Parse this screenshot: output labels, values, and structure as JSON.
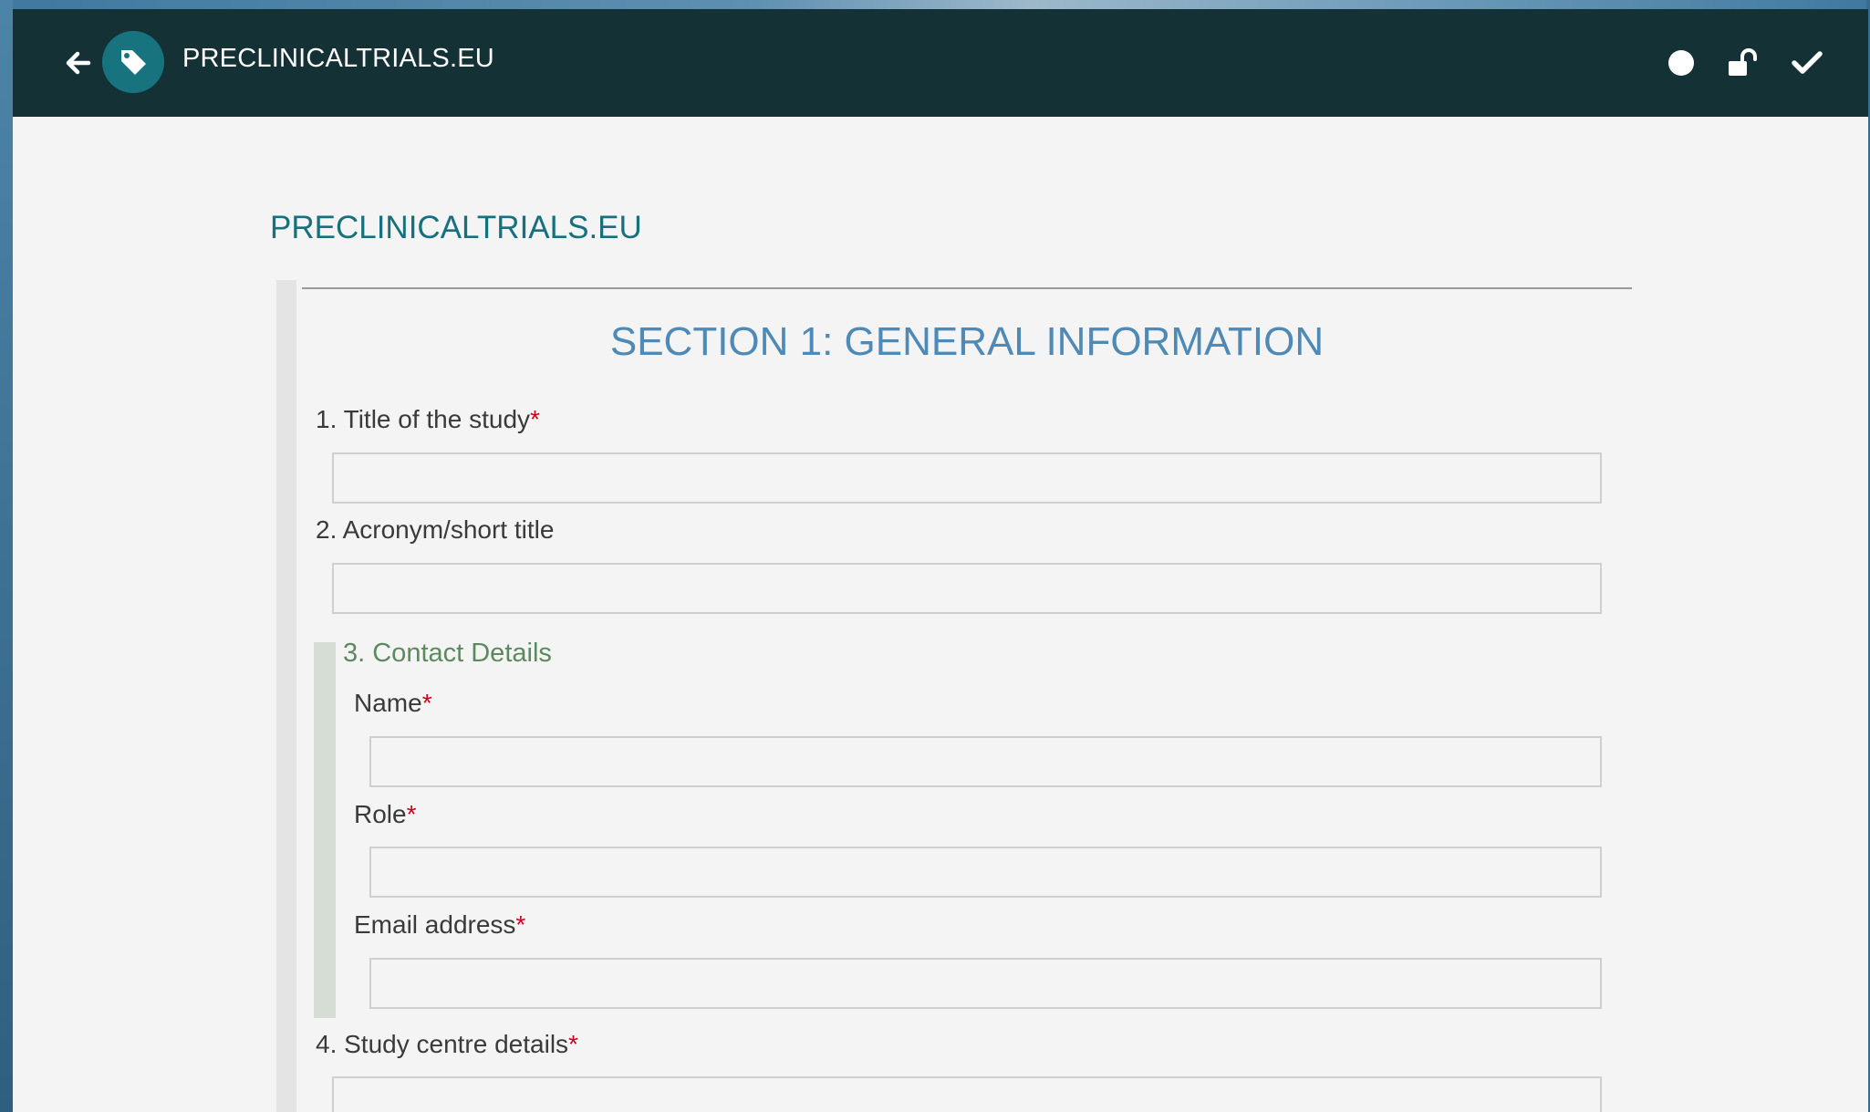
{
  "topbar": {
    "title": "PRECLINICALTRIALS.EU",
    "back_icon": "arrow-left-icon",
    "tag_icon": "tag-icon",
    "status_icon": "circle-icon",
    "lock_icon": "unlock-icon",
    "confirm_icon": "checkmark-icon",
    "background_color": "#143236",
    "accent_color": "#17747f"
  },
  "page": {
    "heading": "PRECLINICALTRIALS.EU"
  },
  "section": {
    "title": "SECTION 1: GENERAL INFORMATION"
  },
  "fields": {
    "title_of_study": {
      "label": "1. Title of the study",
      "required_mark": "*",
      "value": ""
    },
    "acronym": {
      "label": "2. Acronym/short title",
      "value": ""
    },
    "contact_details": {
      "title": "3. Contact Details",
      "name": {
        "label": "Name",
        "required_mark": "*",
        "value": ""
      },
      "role": {
        "label": "Role",
        "required_mark": "*",
        "value": ""
      },
      "email": {
        "label": "Email address",
        "required_mark": "*",
        "value": ""
      }
    },
    "study_centre": {
      "label": "4. Study centre details",
      "required_mark": "*",
      "value": ""
    }
  },
  "colors": {
    "required": "#d0021b",
    "section_title": "#4e8ab5",
    "heading": "#16707e",
    "subsection": "#5c8a5f"
  }
}
